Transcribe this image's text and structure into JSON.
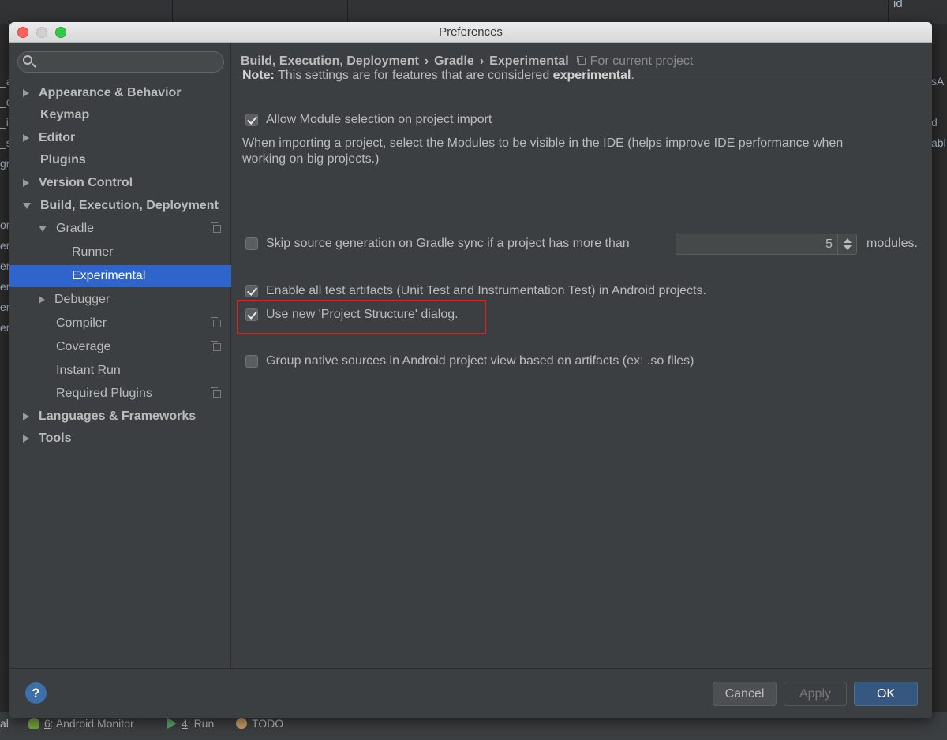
{
  "window": {
    "title": "Preferences"
  },
  "search": {
    "placeholder": "",
    "value": ""
  },
  "sidebar": {
    "items": [
      {
        "label": "Appearance & Behavior",
        "arrow": "right",
        "bold": true
      },
      {
        "label": "Keymap",
        "arrow": "none",
        "bold": true
      },
      {
        "label": "Editor",
        "arrow": "right",
        "bold": true
      },
      {
        "label": "Plugins",
        "arrow": "none",
        "bold": true
      },
      {
        "label": "Version Control",
        "arrow": "right",
        "bold": true
      },
      {
        "label": "Build, Execution, Deployment",
        "arrow": "down",
        "bold": true
      },
      {
        "label": "Gradle",
        "arrow": "down",
        "bold": false
      },
      {
        "label": "Runner",
        "arrow": "none",
        "bold": false
      },
      {
        "label": "Experimental",
        "arrow": "none",
        "bold": false,
        "selected": true
      },
      {
        "label": "Debugger",
        "arrow": "right",
        "bold": false
      },
      {
        "label": "Compiler",
        "arrow": "none",
        "bold": false
      },
      {
        "label": "Coverage",
        "arrow": "none",
        "bold": false
      },
      {
        "label": "Instant Run",
        "arrow": "none",
        "bold": false
      },
      {
        "label": "Required Plugins",
        "arrow": "none",
        "bold": false
      },
      {
        "label": "Languages & Frameworks",
        "arrow": "right",
        "bold": true
      },
      {
        "label": "Tools",
        "arrow": "right",
        "bold": true
      }
    ]
  },
  "breadcrumb": {
    "parts": [
      "Build, Execution, Deployment",
      "Gradle",
      "Experimental"
    ],
    "separator": "›",
    "scope": "For current project"
  },
  "content": {
    "note_prefix": "Note:",
    "note_text": " This settings are for features that are considered ",
    "note_emph": "experimental",
    "note_suffix": ".",
    "options": {
      "allow_module_selection": {
        "label": "Allow Module selection on project import",
        "checked": true
      },
      "allow_module_desc": "When importing a project, select the Modules to be visible in the IDE (helps improve IDE performance when working on big projects.)",
      "skip_source_generation": {
        "label": "Skip source generation on Gradle sync if a project has more than",
        "checked": false,
        "value": "5",
        "suffix": "modules."
      },
      "enable_test_artifacts": {
        "label": "Enable all test artifacts (Unit Test and Instrumentation Test) in Android projects.",
        "checked": true
      },
      "use_new_project_structure": {
        "label": "Use new 'Project Structure' dialog.",
        "checked": true
      },
      "group_native_sources": {
        "label": "Group native sources in Android project view based on artifacts (ex: .so files)",
        "checked": false
      }
    }
  },
  "footer": {
    "help": "?",
    "cancel": "Cancel",
    "apply": "Apply",
    "ok": "OK"
  },
  "background": {
    "toolwindows": [
      {
        "num": "6",
        "label": ": Android Monitor"
      },
      {
        "num": "4",
        "label": ": Run"
      },
      {
        "num": "",
        "label": "TODO"
      }
    ],
    "left_fragments": [
      "_a",
      "_c",
      "_i",
      "_s",
      "gr",
      "",
      "",
      "on",
      "er",
      "er",
      "er",
      "er",
      "er"
    ],
    "right_fragments": [
      "sA",
      "",
      "d",
      "abl"
    ],
    "top_fragment": "id",
    "bottom_left": "al"
  },
  "colors": {
    "accent_selection": "#2f65ca",
    "highlight_border": "#e02020",
    "ok_button": "#365880"
  }
}
